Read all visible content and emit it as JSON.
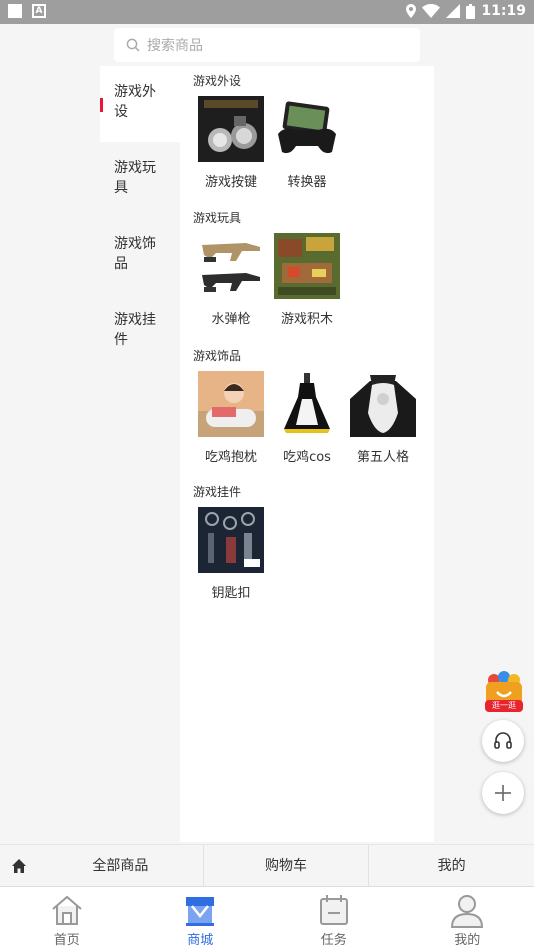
{
  "status_bar": {
    "time": "11:19"
  },
  "search": {
    "placeholder": "搜索商品"
  },
  "categories": [
    {
      "label": "游戏外设",
      "active": true
    },
    {
      "label": "游戏玩具",
      "active": false
    },
    {
      "label": "游戏饰品",
      "active": false
    },
    {
      "label": "游戏挂件",
      "active": false
    }
  ],
  "sections": [
    {
      "title": "游戏外设",
      "items": [
        {
          "label": "游戏按键",
          "icon": "game-buttons-image"
        },
        {
          "label": "转换器",
          "icon": "gamepad-converter-image"
        }
      ]
    },
    {
      "title": "游戏玩具",
      "items": [
        {
          "label": "水弹枪",
          "icon": "water-gun-image"
        },
        {
          "label": "游戏积木",
          "icon": "building-blocks-image"
        }
      ]
    },
    {
      "title": "游戏饰品",
      "items": [
        {
          "label": "吃鸡抱枕",
          "icon": "pillow-image"
        },
        {
          "label": "吃鸡cos",
          "icon": "cosplay-dress-image"
        },
        {
          "label": "第五人格",
          "icon": "identity-v-figure-image"
        }
      ]
    },
    {
      "title": "游戏挂件",
      "items": [
        {
          "label": "钥匙扣",
          "icon": "keychain-image"
        }
      ]
    }
  ],
  "promo": {
    "label": "逛一逛"
  },
  "shop_bar": {
    "items": [
      "全部商品",
      "购物车",
      "我的"
    ]
  },
  "tabbar": {
    "items": [
      {
        "label": "首页",
        "icon": "home-icon",
        "active": false
      },
      {
        "label": "商城",
        "icon": "mall-icon",
        "active": true
      },
      {
        "label": "任务",
        "icon": "task-icon",
        "active": false
      },
      {
        "label": "我的",
        "icon": "profile-icon",
        "active": false
      }
    ]
  },
  "colors": {
    "accent": "#2f6de0",
    "indicator": "#e8173a",
    "status_bar": "#9e9e9e"
  }
}
